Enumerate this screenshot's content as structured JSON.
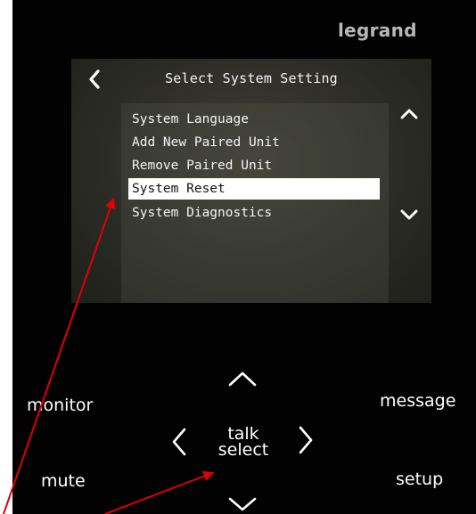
{
  "brand": "legrand",
  "screen": {
    "title": "Select System Setting",
    "menu_items": [
      {
        "label": "System Language",
        "selected": false
      },
      {
        "label": "Add New Paired Unit",
        "selected": false
      },
      {
        "label": "Remove Paired Unit",
        "selected": false
      },
      {
        "label": "System Reset",
        "selected": true
      },
      {
        "label": "System Diagnostics",
        "selected": false
      }
    ],
    "icons": {
      "back": "chevron-left-icon",
      "scroll_up": "chevron-up-icon",
      "scroll_down": "chevron-down-icon"
    }
  },
  "keypad": {
    "monitor_label": "monitor",
    "message_label": "message",
    "mute_label": "mute",
    "setup_label": "setup",
    "center_line1": "talk",
    "center_line2": "select",
    "icons": {
      "up": "chevron-up-icon",
      "down": "chevron-down-icon",
      "left": "chevron-left-icon",
      "right": "chevron-right-icon"
    }
  },
  "colors": {
    "device_body": "#020202",
    "screen_bg": "#303029",
    "highlight_bg": "#ffffff",
    "annotation_arrow": "#e00000",
    "brand_text": "#b8b8b8"
  }
}
